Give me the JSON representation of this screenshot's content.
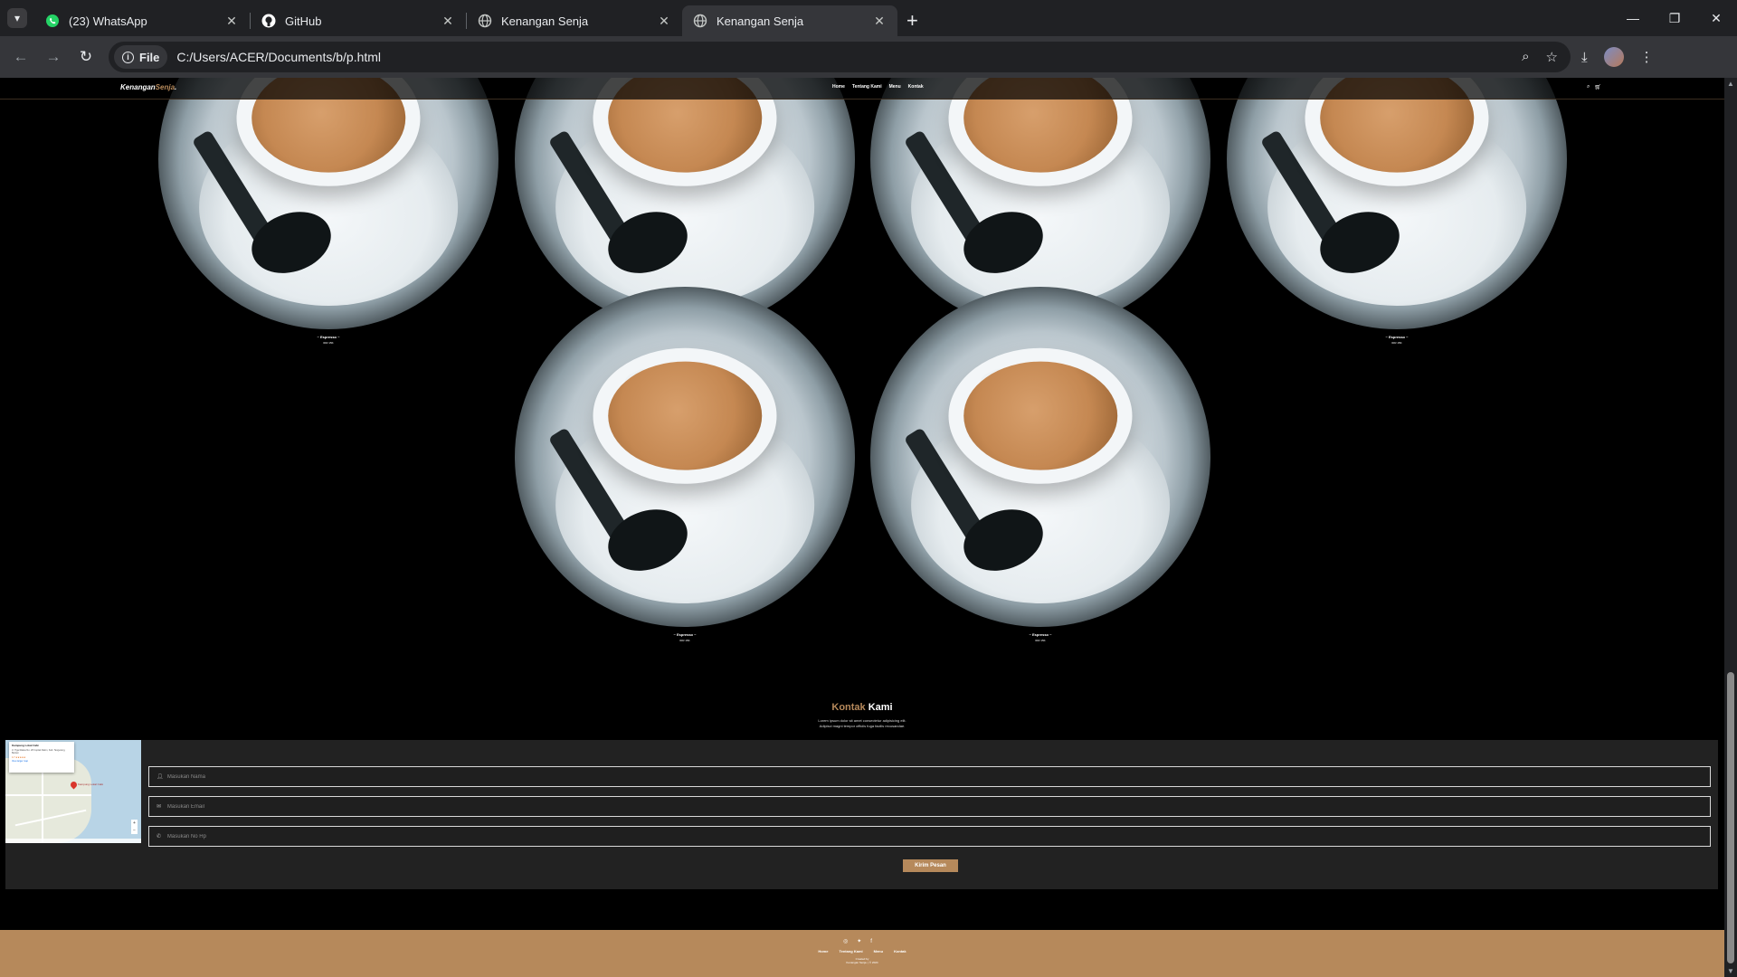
{
  "browser": {
    "tabs": [
      {
        "title": "(23) WhatsApp",
        "icon": "whatsapp-icon"
      },
      {
        "title": "GitHub",
        "icon": "github-icon"
      },
      {
        "title": "Kenangan Senja",
        "icon": "globe-icon"
      },
      {
        "title": "Kenangan Senja",
        "icon": "globe-icon",
        "active": true
      }
    ],
    "chip_label": "File",
    "url": "C:/Users/ACER/Documents/b/p.html"
  },
  "site": {
    "logo_main": "Kenangan",
    "logo_accent": "Senja",
    "logo_dot": ".",
    "nav": [
      "Home",
      "Tentang Kami",
      "Menu",
      "Kontak"
    ],
    "accent_color": "#b6895b"
  },
  "menu": {
    "items": [
      {
        "name": "~ Espresso ~",
        "price": "IDR 15K"
      },
      {
        "name": "~ Espresso ~",
        "price": "IDR 15K"
      },
      {
        "name": "~ Espresso ~",
        "price": "IDR 15K"
      },
      {
        "name": "~ Espresso ~",
        "price": "IDR 15K"
      },
      {
        "name": "~ Espresso ~",
        "price": "IDR 15K"
      },
      {
        "name": "~ Espresso ~",
        "price": "IDR 15K"
      }
    ]
  },
  "contact": {
    "title_accent": "Kontak",
    "title_main": "Kami",
    "desc_line1": "Lorem ipsum dolor sit amet consectetur adipisicing elit.",
    "desc_line2": "Adipisci magni tempor officiis fuga facilis recusandae.",
    "map": {
      "place": "Kampung Lokal Café",
      "address": "Jl. Tiga Raksa No. 28 Cuplak Ralon, Kab. Tangerang, Banten",
      "rating": "4.7 ★★★★★",
      "link": "View larger map",
      "pin_label": "Kampung Lokal Café"
    },
    "fields": [
      {
        "placeholder": "Masukan Nama",
        "icon": "user-icon"
      },
      {
        "placeholder": "Masukan Email",
        "icon": "mail-icon"
      },
      {
        "placeholder": "Masukan No Hp",
        "icon": "phone-icon"
      }
    ],
    "submit_label": "Kirim Pesan"
  },
  "footer": {
    "links": [
      "Home",
      "Tentang Kami",
      "Menu",
      "Kontak"
    ],
    "credit_line1": "Created by",
    "credit_line2": "Kenangan Senja. | © 2024"
  }
}
